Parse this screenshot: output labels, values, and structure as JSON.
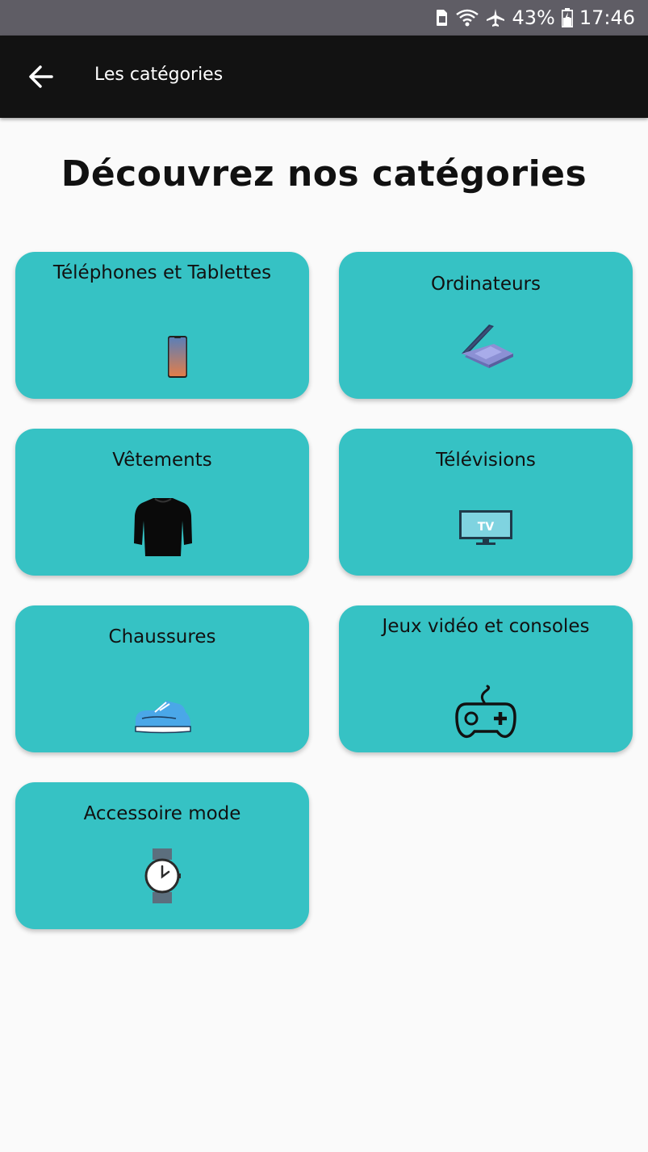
{
  "status_bar": {
    "battery": "43%",
    "time": "17:46"
  },
  "app_bar": {
    "title": "Les catégories"
  },
  "heading": "Découvrez nos catégories",
  "categories": [
    {
      "label": "Téléphones et Tablettes",
      "icon": "smartphone-icon"
    },
    {
      "label": "Ordinateurs",
      "icon": "laptop-icon"
    },
    {
      "label": "Vêtements",
      "icon": "sweater-icon"
    },
    {
      "label": "Télévisions",
      "icon": "tv-icon"
    },
    {
      "label": "Chaussures",
      "icon": "sneaker-icon"
    },
    {
      "label": "Jeux vidéo et consoles",
      "icon": "gamepad-icon"
    },
    {
      "label": "Accessoire mode",
      "icon": "watch-icon"
    }
  ],
  "tv_icon_text": "TV",
  "colors": {
    "card": "#36c2c4",
    "app_bar": "#121212",
    "status_bar": "#5f5d65",
    "background": "#fafafa"
  }
}
